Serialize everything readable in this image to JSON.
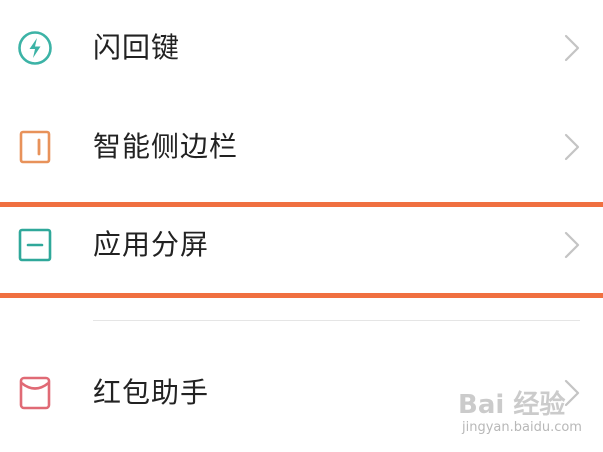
{
  "menu": {
    "items": [
      {
        "label": "闪回键",
        "icon": "flash-bolt-icon",
        "color": "#3cb3a6"
      },
      {
        "label": "智能侧边栏",
        "icon": "sidebar-icon",
        "color": "#e8925a"
      },
      {
        "label": "应用分屏",
        "icon": "split-screen-icon",
        "color": "#2fa89a"
      },
      {
        "label": "红包助手",
        "icon": "red-envelope-icon",
        "color": "#e06a75"
      }
    ]
  },
  "highlight": {
    "color": "#f07040"
  },
  "watermark": {
    "logo": "Bai 经验",
    "sub": "jingyan.baidu.com"
  }
}
